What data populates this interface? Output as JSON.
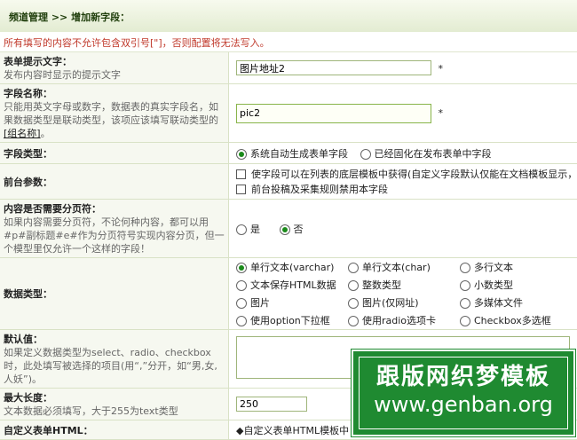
{
  "breadcrumb": "频道管理 >> 增加新字段：",
  "notice": "所有填写的内容不允许包含双引号[\"]，否则配置将无法写入。",
  "fields": {
    "itemname": {
      "label": "表单提示文字：",
      "desc": "发布内容时显示的提示文字",
      "value": "图片地址2",
      "required": "*"
    },
    "fieldname": {
      "label": "字段名称：",
      "desc": "只能用英文字母或数字，数据表的真实字段名，如果数据类型是联动类型，该项应该填写联动类型的",
      "link": "[组名称]",
      "desc_end": "。",
      "value": "pic2",
      "required": "*"
    },
    "fieldtype": {
      "label": "字段类型：",
      "options": [
        "系统自动生成表单字段",
        "已经固化在发布表单中字段"
      ],
      "selected": 0
    },
    "frontend": {
      "label": "前台参数：",
      "checks": [
        "使字段可以在列表的底层模板中获得(自定义字段默认仅能在文档模板显示，启",
        "前台投稿及采集规则禁用本字段"
      ]
    },
    "paging": {
      "label": "内容是否需要分页符：",
      "desc": "如果内容需要分页符，不论何种内容，都可以用#p#副标题#e#作为分页符号实现内容分页，但一个模型里仅允许一个这样的字段！",
      "options": [
        "是",
        "否"
      ],
      "selected": 1
    },
    "datatype": {
      "label": "数据类型：",
      "options": [
        "单行文本(varchar)",
        "单行文本(char)",
        "多行文本",
        "文本保存HTML数据",
        "整数类型",
        "小数类型",
        "图片",
        "图片(仅网址)",
        "多媒体文件",
        "使用option下拉框",
        "使用radio选项卡",
        "Checkbox多选框"
      ],
      "selected": 0
    },
    "default": {
      "label": "默认值：",
      "desc": "如果定义数据类型为select、radio、checkbox时，此处填写被选择的项目(用“,”分开，如“男,女,人妖”)。",
      "value": ""
    },
    "maxlength": {
      "label": "最大长度：",
      "desc": "文本数据必须填写，大于255为text类型",
      "value": "250"
    },
    "customhtml": {
      "label": "自定义表单HTML：",
      "hint": "◆自定义表单HTML模板中"
    }
  },
  "watermark": {
    "line1": "跟版网织梦模板",
    "line2": "www.genban.org"
  }
}
